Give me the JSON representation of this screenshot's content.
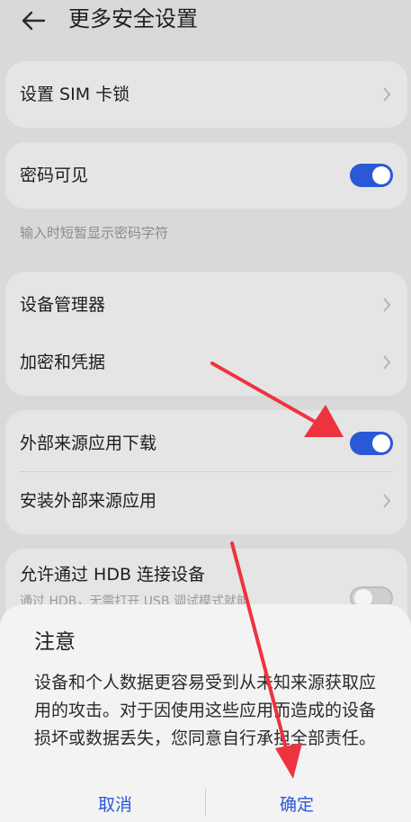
{
  "header": {
    "title": "更多安全设置"
  },
  "rows": {
    "sim_lock": "设置 SIM 卡锁",
    "password_visible": "密码可见",
    "password_hint": "输入时短暂显示密码字符",
    "device_admin": "设备管理器",
    "encryption": "加密和凭据",
    "external_download": "外部来源应用下载",
    "install_external": "安装外部来源应用",
    "hdb_connect": "允许通过 HDB 连接设备",
    "hdb_sub": "通过 HDB，无需打开 USB 调试模式就能"
  },
  "toggles": {
    "password_visible": true,
    "external_download": true,
    "hdb_connect": false
  },
  "dialog": {
    "title": "注意",
    "body": "设备和个人数据更容易受到从未知来源获取应用的攻击。对于因使用这些应用而造成的设备损坏或数据丢失，您同意自行承担全部责任。",
    "cancel": "取消",
    "ok": "确定"
  },
  "colors": {
    "accent": "#2a59d6",
    "annotation_arrow": "#ee3340"
  }
}
